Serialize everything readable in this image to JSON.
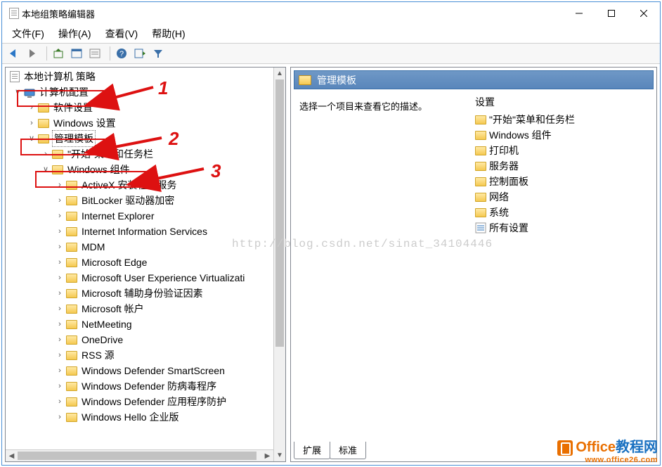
{
  "window": {
    "title": "本地组策略编辑器"
  },
  "menu": {
    "file": "文件(F)",
    "action": "操作(A)",
    "view": "查看(V)",
    "help": "帮助(H)"
  },
  "tree": {
    "root": "本地计算机 策略",
    "computer_config": "计算机配置",
    "software": "软件设置",
    "windows_settings": "Windows 设置",
    "admin_templates": "管理模板",
    "start_taskbar": "\"开始\"菜单和任务栏",
    "windows_components": "Windows 组件",
    "items": [
      "ActiveX 安装程序服务",
      "BitLocker 驱动器加密",
      "Internet Explorer",
      "Internet Information Services",
      "MDM",
      "Microsoft Edge",
      "Microsoft User Experience Virtualizati",
      "Microsoft 辅助身份验证因素",
      "Microsoft 帐户",
      "NetMeeting",
      "OneDrive",
      "RSS 源",
      "Windows Defender SmartScreen",
      "Windows Defender 防病毒程序",
      "Windows Defender 应用程序防护",
      "Windows Hello 企业版"
    ]
  },
  "right": {
    "header": "管理模板",
    "prompt": "选择一个项目来查看它的描述。",
    "settings_header": "设置",
    "items": [
      "\"开始\"菜单和任务栏",
      "Windows 组件",
      "打印机",
      "服务器",
      "控制面板",
      "网络",
      "系统"
    ],
    "all_settings": "所有设置"
  },
  "tabs": {
    "ext": "扩展",
    "std": "标准"
  },
  "annot": {
    "n1": "1",
    "n2": "2",
    "n3": "3"
  },
  "watermark": "http://blog.csdn.net/sinat_34104446",
  "logo": {
    "line1a": "Office",
    "line1b": "教程网",
    "line2": "www.office26.com"
  }
}
